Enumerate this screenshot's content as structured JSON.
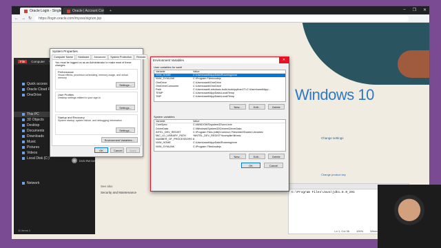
{
  "browser": {
    "tabs": [
      {
        "label": "Oracle Login - Single Sign On",
        "active": true
      },
      {
        "label": "Oracle | Account Confirmation",
        "active": false
      }
    ],
    "new_tab": "+",
    "url": "https://login.oracle.com/mysso/signon.jsp",
    "controls": [
      "–",
      "❐",
      "✕"
    ]
  },
  "explorer": {
    "menu": [
      "File",
      "Computer",
      "View"
    ],
    "nav_items": [
      {
        "label": "Quick access",
        "selected": false
      },
      {
        "label": "Oracle Cloud Files",
        "selected": false
      },
      {
        "label": "OneDrive",
        "selected": false
      },
      {
        "label": "This PC",
        "selected": true
      },
      {
        "label": "3D Objects",
        "selected": false
      },
      {
        "label": "Desktop",
        "selected": false
      },
      {
        "label": "Documents",
        "selected": false
      },
      {
        "label": "Downloads",
        "selected": false
      },
      {
        "label": "Music",
        "selected": false
      },
      {
        "label": "Pictures",
        "selected": false
      },
      {
        "label": "Videos",
        "selected": false
      },
      {
        "label": "Local Disk (C:)",
        "selected": false
      },
      {
        "label": "Network",
        "selected": false
      }
    ],
    "status": "11 items   1",
    "dvd_label": "DVD RW Drive"
  },
  "settings_page": {
    "windows10": "Windows 10",
    "change_settings": "Change settings",
    "change_product_key": "Change product key",
    "see_also": "See also",
    "security": "Security and Maintenance"
  },
  "terminal": {
    "command": "C:\\Program Files\\Java\\jdk1.8.0_291",
    "status_pos": "Ln 1, Col 36",
    "status_zoom": "100%",
    "status_eol": "Windows (CRLF)",
    "status_enc": "UTF-8"
  },
  "system_properties": {
    "title": "System Properties",
    "tabs": [
      "Computer Name",
      "Hardware",
      "Advanced",
      "System Protection",
      "Remote"
    ],
    "active_tab": "Advanced",
    "note": "You must be logged on as an Administrator to make most of these changes.",
    "groups": [
      {
        "title": "Performance",
        "desc": "Visual effects, processor scheduling, memory usage, and virtual memory",
        "button": "Settings..."
      },
      {
        "title": "User Profiles",
        "desc": "Desktop settings related to your sign-in",
        "button": "Settings..."
      },
      {
        "title": "Startup and Recovery",
        "desc": "System startup, system failure, and debugging information",
        "button": "Settings..."
      }
    ],
    "env_button": "Environment Variables...",
    "ok": "OK",
    "cancel": "Cancel",
    "apply": "Apply"
  },
  "env_vars": {
    "title": "Environment Variables",
    "close": "✕",
    "user_label": "User variables for santi",
    "col_variable": "Variable",
    "col_value": "Value",
    "user_vars": [
      {
        "name": "NVM_HOME",
        "value": "C:\\Users\\santi\\AppData\\Roaming\\nvm",
        "selected": true
      },
      {
        "name": "NVM_SYMLINK",
        "value": "C:\\Program Files\\nodejs",
        "selected": false
      },
      {
        "name": "OneDrive",
        "value": "C:\\Users\\santi\\OneDrive",
        "selected": false
      },
      {
        "name": "OneDriveConsumer",
        "value": "C:\\Users\\santi\\OneDrive",
        "selected": false
      },
      {
        "name": "Path",
        "value": "C:\\Users\\santi\\.windows-build-tools\\python27\\;C:\\Users\\santi\\App...",
        "selected": false
      },
      {
        "name": "TEMP",
        "value": "C:\\Users\\santi\\AppData\\Local\\Temp",
        "selected": false
      },
      {
        "name": "TMP",
        "value": "C:\\Users\\santi\\AppData\\Local\\Temp",
        "selected": false
      }
    ],
    "user_buttons": [
      "New...",
      "Edit...",
      "Delete"
    ],
    "system_label": "System variables",
    "system_vars": [
      {
        "name": "ComSpec",
        "value": "C:\\WINDOWS\\system32\\cmd.exe"
      },
      {
        "name": "DriverData",
        "value": "C:\\Windows\\System32\\Drivers\\DriverData"
      },
      {
        "name": "INTEL_DEV_REDIST",
        "value": "C:\\Program Files (x86)\\Common Files\\Intel\\Shared Libraries\\"
      },
      {
        "name": "MIC_LD_LIBRARY_PATH",
        "value": "%INTEL_DEV_REDIST%compiler\\lib\\mic"
      },
      {
        "name": "NUMBER_OF_PROCESSORS",
        "value": "8"
      },
      {
        "name": "NVM_HOME",
        "value": "C:\\Users\\santi\\AppData\\Roaming\\nvm"
      },
      {
        "name": "NVM_SYMLINK",
        "value": "C:\\Program Files\\nodejs"
      }
    ],
    "system_buttons": [
      "New...",
      "Edit...",
      "Delete"
    ],
    "ok": "OK",
    "cancel": "Cancel"
  }
}
